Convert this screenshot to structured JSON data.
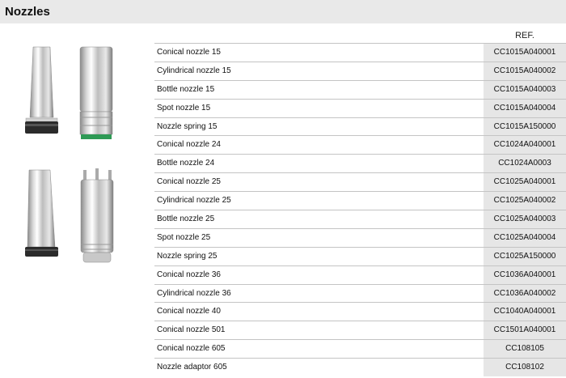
{
  "title": "Nozzles",
  "ref_header": "REF.",
  "rows": [
    {
      "name": "Conical nozzle 15",
      "ref": "CC1015A040001"
    },
    {
      "name": "Cylindrical nozzle 15",
      "ref": "CC1015A040002"
    },
    {
      "name": "Bottle nozzle 15",
      "ref": "CC1015A040003"
    },
    {
      "name": "Spot nozzle 15",
      "ref": "CC1015A040004"
    },
    {
      "name": "Nozzle spring 15",
      "ref": "CC1015A150000"
    },
    {
      "name": "Conical nozzle 24",
      "ref": "CC1024A040001"
    },
    {
      "name": "Bottle nozzle 24",
      "ref": "CC1024A0003"
    },
    {
      "name": "Conical nozzle 25",
      "ref": "CC1025A040001"
    },
    {
      "name": "Cylindrical nozzle 25",
      "ref": "CC1025A040002"
    },
    {
      "name": "Bottle nozzle 25",
      "ref": "CC1025A040003"
    },
    {
      "name": "Spot nozzle 25",
      "ref": "CC1025A040004"
    },
    {
      "name": "Nozzle spring 25",
      "ref": "CC1025A150000"
    },
    {
      "name": "Conical nozzle 36",
      "ref": "CC1036A040001"
    },
    {
      "name": "Cylindrical nozzle 36",
      "ref": "CC1036A040002"
    },
    {
      "name": "Conical nozzle 40",
      "ref": "CC1040A040001"
    },
    {
      "name": "Conical nozzle 501",
      "ref": "CC1501A040001"
    },
    {
      "name": "Conical nozzle 605",
      "ref": "CC108105"
    },
    {
      "name": "Nozzle adaptor 605",
      "ref": "CC108102"
    }
  ]
}
